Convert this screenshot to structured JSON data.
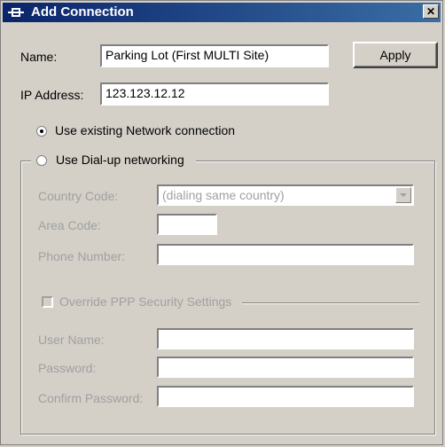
{
  "window": {
    "title": "Add Connection",
    "close_glyph": "✕"
  },
  "form": {
    "name_label": "Name:",
    "name_value": "Parking Lot (First MULTI Site)",
    "apply_label": "Apply",
    "ip_label": "IP Address:",
    "ip_value": "123.123.12.12"
  },
  "connection": {
    "existing_label": "Use existing Network connection",
    "existing_selected": true,
    "dialup_label": "Use Dial-up networking",
    "dialup_selected": false
  },
  "dialup": {
    "country_label": "Country Code:",
    "country_value": "(dialing same country)",
    "area_label": "Area Code:",
    "area_value": "",
    "phone_label": "Phone Number:",
    "phone_value": ""
  },
  "security": {
    "override_label": "Override PPP Security Settings",
    "override_checked": false,
    "username_label": "User Name:",
    "username_value": "",
    "password_label": "Password:",
    "password_value": "",
    "confirm_label": "Confirm Password:",
    "confirm_value": ""
  },
  "colors": {
    "title_start": "#0a246a",
    "title_end": "#3a6ea5",
    "face": "#d4d0c8",
    "disabled_text": "#a0a0a0"
  }
}
